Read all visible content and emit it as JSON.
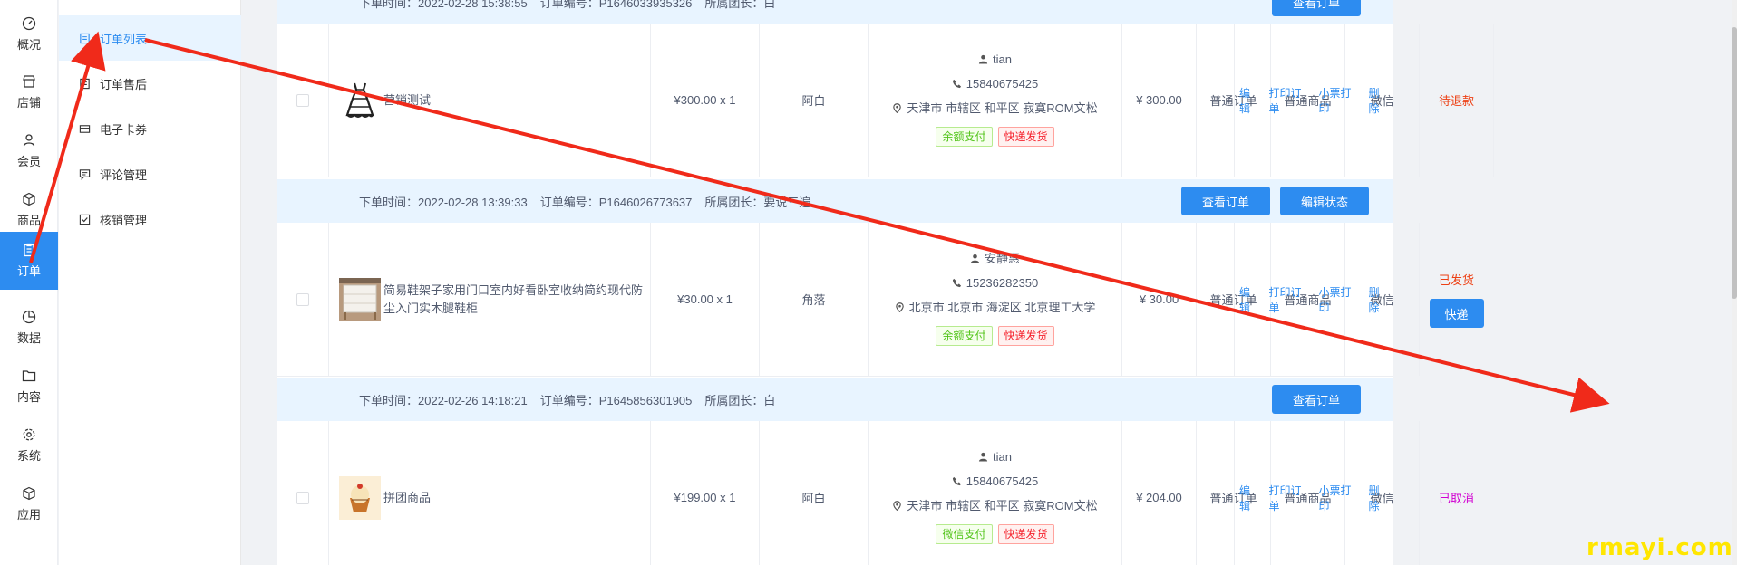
{
  "rail": [
    {
      "label": "概况",
      "icon": "dashboard-icon"
    },
    {
      "label": "店铺",
      "icon": "store-icon"
    },
    {
      "label": "会员",
      "icon": "member-icon"
    },
    {
      "label": "商品",
      "icon": "product-icon"
    },
    {
      "label": "订单",
      "icon": "order-icon",
      "active": true
    },
    {
      "label": "数据",
      "icon": "data-icon"
    },
    {
      "label": "内容",
      "icon": "content-icon"
    },
    {
      "label": "系统",
      "icon": "system-icon"
    },
    {
      "label": "应用",
      "icon": "app-icon"
    }
  ],
  "submenu": [
    {
      "label": "订单列表",
      "icon": "order-list-icon",
      "active": true
    },
    {
      "label": "订单售后",
      "icon": "after-sale-icon"
    },
    {
      "label": "电子卡券",
      "icon": "card-icon"
    },
    {
      "label": "评论管理",
      "icon": "comment-icon"
    },
    {
      "label": "核销管理",
      "icon": "verify-icon"
    }
  ],
  "orders": [
    {
      "header": {
        "time": "下单时间：2022-02-28 15:38:55",
        "no": "订单编号：P1646033935326",
        "leader": "所属团长：白"
      },
      "buttons": [
        "查看订单"
      ],
      "product": "营销测试",
      "price": "¥300.00 x 1",
      "spec": "阿白",
      "buyer": "tian",
      "phone": "15840675425",
      "address": "天津市 市辖区 和平区 寂寞ROM文松",
      "pay_tag": "余额支付",
      "ship_tag": "快递发货",
      "amount": "¥ 300.00",
      "order_type": "普通订单",
      "goods_type": "普通商品",
      "channel": "微信",
      "status": "待退款",
      "status_color": "#ed4014",
      "ops": [
        "编辑",
        "打印订单",
        "小票打印",
        "删除"
      ]
    },
    {
      "header": {
        "time": "下单时间：2022-02-28 13:39:33",
        "no": "订单编号：P1646026773637",
        "leader": "所属团长：要说三遍"
      },
      "buttons": [
        "查看订单",
        "编辑状态"
      ],
      "product": "简易鞋架子家用门口室内好看卧室收纳简约现代防尘入门实木腿鞋柜",
      "price": "¥30.00 x 1",
      "spec": "角落",
      "buyer": "安静惠",
      "phone": "15236282350",
      "address": "北京市 北京市 海淀区 北京理工大学",
      "pay_tag": "余额支付",
      "ship_tag": "快递发货",
      "amount": "¥ 30.00",
      "order_type": "普通订单",
      "goods_type": "普通商品",
      "channel": "微信",
      "status": "已发货",
      "status_color": "#ed4014",
      "status_button": "快递",
      "ops": [
        "编辑",
        "打印订单",
        "小票打印",
        "删除"
      ]
    },
    {
      "header": {
        "time": "下单时间：2022-02-26 14:18:21",
        "no": "订单编号：P1645856301905",
        "leader": "所属团长：白"
      },
      "buttons": [
        "查看订单"
      ],
      "product": "拼团商品",
      "price": "¥199.00 x 1",
      "spec": "阿白",
      "buyer": "tian",
      "phone": "15840675425",
      "address": "天津市 市辖区 和平区 寂寞ROM文松",
      "pay_tag": "微信支付",
      "ship_tag": "快递发货",
      "amount": "¥ 204.00",
      "order_type": "普通订单",
      "goods_type": "普通商品",
      "channel": "微信",
      "status": "已取消",
      "status_color": "#d100d1",
      "ops": [
        "编辑",
        "打印订单",
        "小票打印",
        "删除"
      ]
    }
  ],
  "watermark": "rmayi.com",
  "colors": {
    "primary": "#2d8cf0",
    "header_bg": "#e8f4ff",
    "arrow": "#f02a1a"
  }
}
